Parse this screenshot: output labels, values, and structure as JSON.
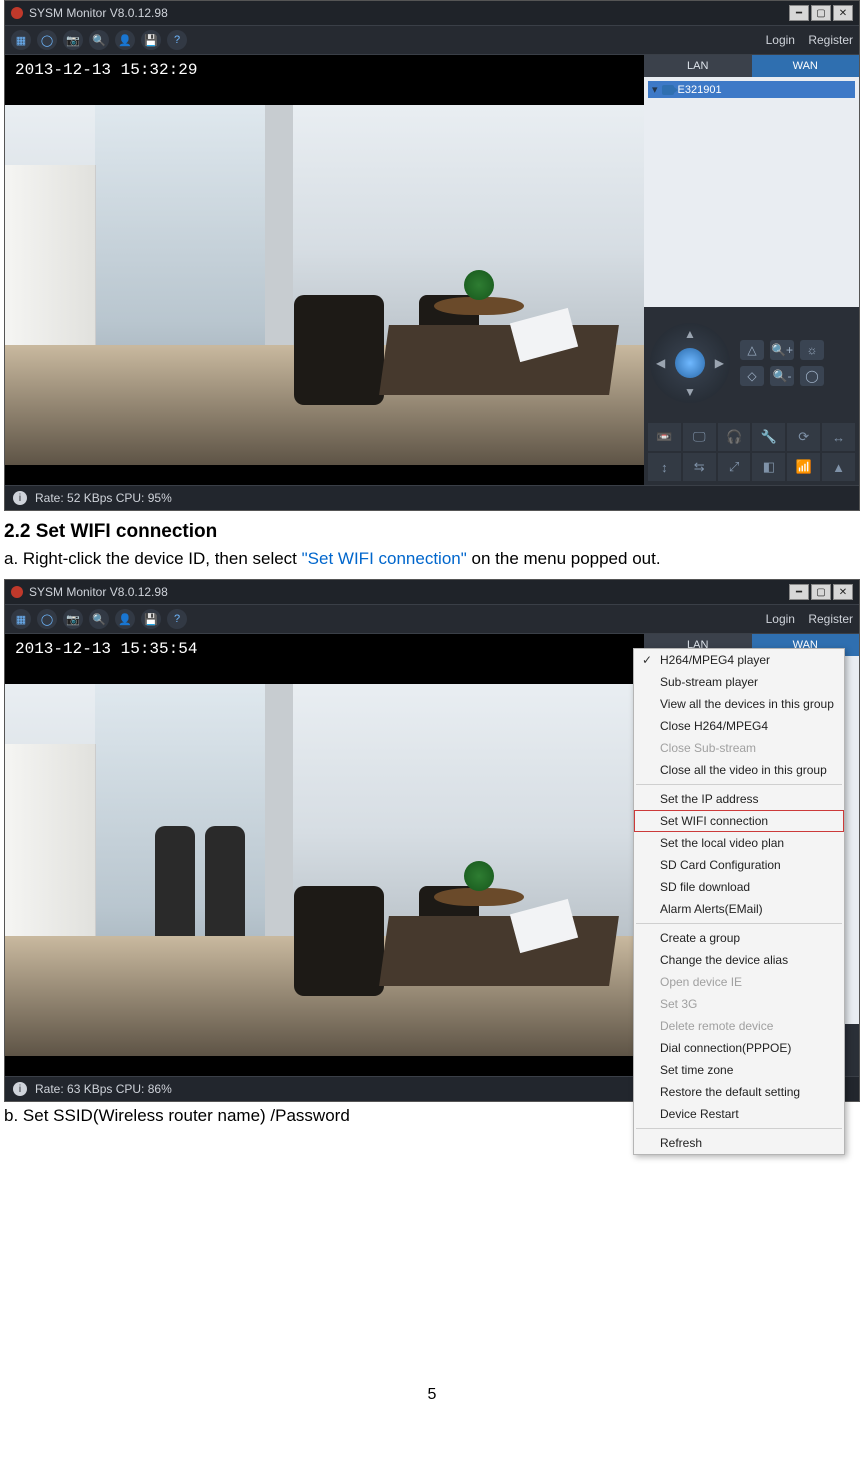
{
  "screenshot1": {
    "title": "SYSM Monitor  V8.0.12.98",
    "toolbar_icons": [
      "grid-icon",
      "record-icon",
      "snapshot-icon",
      "ptz-icon",
      "user-icon",
      "save-icon",
      "help-icon"
    ],
    "auth": {
      "login": "Login",
      "register": "Register"
    },
    "tabs": {
      "lan": "LAN",
      "wan": "WAN",
      "active": "wan"
    },
    "device_id": "E321901",
    "timestamp": "2013-12-13 15:32:29",
    "ptz_icons": [
      "▲",
      "◆",
      "+",
      "-",
      "☼",
      "◯"
    ],
    "toolgrid_icons": [
      "📼",
      "🖵",
      "🎧",
      "🔧",
      "⟳",
      "↔",
      "↕",
      "⇆",
      "⤢",
      "◧",
      "📶",
      "▲",
      "☼"
    ],
    "status": "Rate: 52 KBps  CPU:  95%"
  },
  "doc": {
    "heading": "2.2 Set WIFI connection",
    "step_a_pre": "a. Right-click the device ID, then select ",
    "step_a_link": "\"Set WIFI connection\"",
    "step_a_post": " on the menu popped out.",
    "step_b": "b. Set SSID(Wireless router name) /Password",
    "page_number": "5"
  },
  "screenshot2": {
    "title": "SYSM Monitor  V8.0.12.98",
    "auth": {
      "login": "Login",
      "register": "Register"
    },
    "tabs": {
      "lan": "LAN",
      "wan": "WAN",
      "active": "wan"
    },
    "timestamp": "2013-12-13 15:35:54",
    "status": "Rate: 63 KBps  CPU:  86%",
    "context_menu": [
      {
        "label": "H264/MPEG4 player",
        "checked": true
      },
      {
        "label": "Sub-stream player"
      },
      {
        "label": "View all the devices in this group"
      },
      {
        "label": "Close H264/MPEG4"
      },
      {
        "label": "Close Sub-stream",
        "disabled": true
      },
      {
        "label": "Close all the video in this group"
      },
      {
        "sep": true
      },
      {
        "label": "Set the IP address"
      },
      {
        "label": "Set WIFI connection",
        "highlight": true
      },
      {
        "label": "Set the local video plan"
      },
      {
        "label": "SD Card Configuration"
      },
      {
        "label": "SD file download"
      },
      {
        "label": "Alarm Alerts(EMail)"
      },
      {
        "sep": true
      },
      {
        "label": "Create a group"
      },
      {
        "label": "Change the device alias"
      },
      {
        "label": "Open device IE",
        "disabled": true
      },
      {
        "label": "Set 3G",
        "disabled": true
      },
      {
        "label": "Delete remote device",
        "disabled": true
      },
      {
        "label": "Dial connection(PPPOE)"
      },
      {
        "label": "Set time zone"
      },
      {
        "label": "Restore the default setting"
      },
      {
        "label": "Device Restart"
      },
      {
        "sep": true
      },
      {
        "label": "Refresh"
      }
    ]
  }
}
